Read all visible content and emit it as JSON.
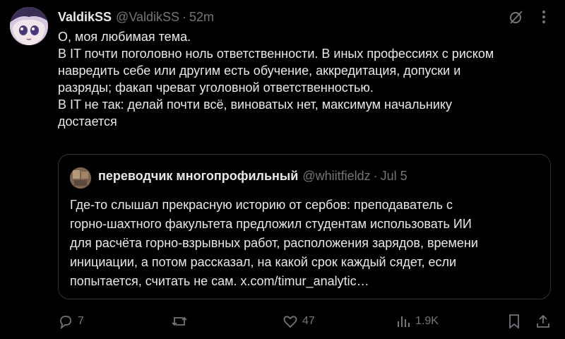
{
  "tweet": {
    "author_name": "ValdikSS",
    "author_handle": "@ValdikSS",
    "separator": "·",
    "time": "52m",
    "lines": [
      "О, моя любимая тема.",
      "В IT почти поголовно ноль ответственности. В иных профессиях с риском",
      "навредить себе или другим есть обучение, аккредитация, допуски и",
      "разряды; факап чреват уголовной ответственностью.",
      "В IT не так: делай почти всё, виноватых нет, максимум начальнику",
      "достается"
    ]
  },
  "quoted": {
    "author_name": "переводчик многопрофильный",
    "author_handle": "@whiitfieldz",
    "separator": "·",
    "time": "Jul 5",
    "lines": [
      "Где-то слышал прекрасную историю от сербов: преподаватель с",
      "горно-шахтного факультета предложил студентам использовать ИИ",
      "для расчёта горно-взрывных работ, расположения зарядов, времени",
      "инициации, а потом рассказал, на какой срок каждый сядет, если",
      "попытается, считать не сам. x.com/timur_analytic…"
    ]
  },
  "actions": {
    "replies": "7",
    "reposts": "",
    "likes": "47",
    "views": "1.9K"
  },
  "colors": {
    "background": "#000000",
    "text": "#e7e9ea",
    "muted": "#71767b",
    "border": "#2f3336"
  },
  "icons": [
    "grok-icon",
    "more-icon",
    "reply-icon",
    "repost-icon",
    "like-icon",
    "views-icon",
    "bookmark-icon",
    "share-icon"
  ]
}
